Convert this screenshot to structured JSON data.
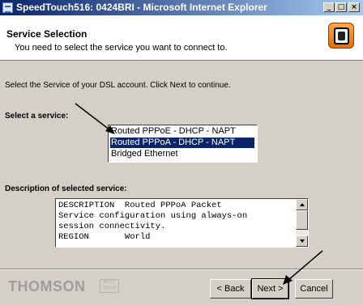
{
  "window": {
    "title": "SpeedTouch516: 0424BRI - Microsoft Internet Explorer",
    "controls": {
      "minimize": "_",
      "maximize": "□",
      "close": "×"
    }
  },
  "header": {
    "title": "Service Selection",
    "subtitle": "You need to select the service you want to connect to.",
    "icon": "speedtouch-app-icon"
  },
  "instruction": "Select the Service of your DSL account. Click Next to continue.",
  "service_section": {
    "label": "Select a service:",
    "options": [
      {
        "label": "Routed PPPoE - DHCP - NAPT",
        "selected": false
      },
      {
        "label": "Routed PPPoA - DHCP - NAPT",
        "selected": true
      },
      {
        "label": "Bridged Ethernet",
        "selected": false
      }
    ]
  },
  "description_section": {
    "label": "Description of selected service:",
    "lines": [
      "DESCRIPTION  Routed PPPoA Packet",
      "Service configuration using always-on",
      "session connectivity.",
      "REGION       World"
    ]
  },
  "footer": {
    "logo_text": "THOMSON",
    "logo_mark_text": "MULTI MEDIA",
    "buttons": {
      "back": "< Back",
      "next": "Next >",
      "cancel": "Cancel"
    }
  },
  "colors": {
    "titlebar_start": "#0a246a",
    "titlebar_end": "#a6caf0",
    "selection": "#0a246a",
    "dialog_bg": "#d4d0c8"
  }
}
